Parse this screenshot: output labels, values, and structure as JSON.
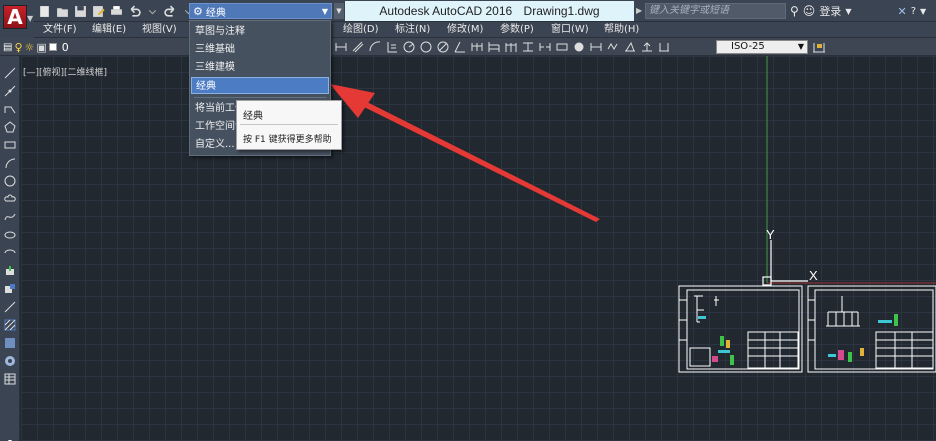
{
  "app": {
    "name": "Autodesk AutoCAD 2016",
    "document": "Drawing1.dwg",
    "logo_letter": "A"
  },
  "workspace": {
    "current": "经典",
    "options": [
      "草图与注释",
      "三维基础",
      "三维建模",
      "经典"
    ],
    "selected_index": 3,
    "actions": [
      "将当前工作",
      "工作空间设",
      "自定义..."
    ]
  },
  "tooltip": {
    "title": "经典",
    "help": "按 F1 键获得更多帮助"
  },
  "search": {
    "placeholder": "键入关键字或短语"
  },
  "account": {
    "login": "登录"
  },
  "menu": [
    "文件(F)",
    "编辑(E)",
    "视图(V)",
    "绘图(D)",
    "标注(N)",
    "修改(M)",
    "参数(P)",
    "窗口(W)",
    "帮助(H)"
  ],
  "layer": {
    "name": "0"
  },
  "dimstyle": {
    "value": "ISO-25"
  },
  "viewport": {
    "label": "[—][俯视][二维线框]"
  },
  "ucs": {
    "y": "Y",
    "x": "X"
  },
  "colors": {
    "accent": "#4b7cc4",
    "canvas": "#212830",
    "arrow": "#e53935",
    "title_bg": "#dff3fb"
  }
}
